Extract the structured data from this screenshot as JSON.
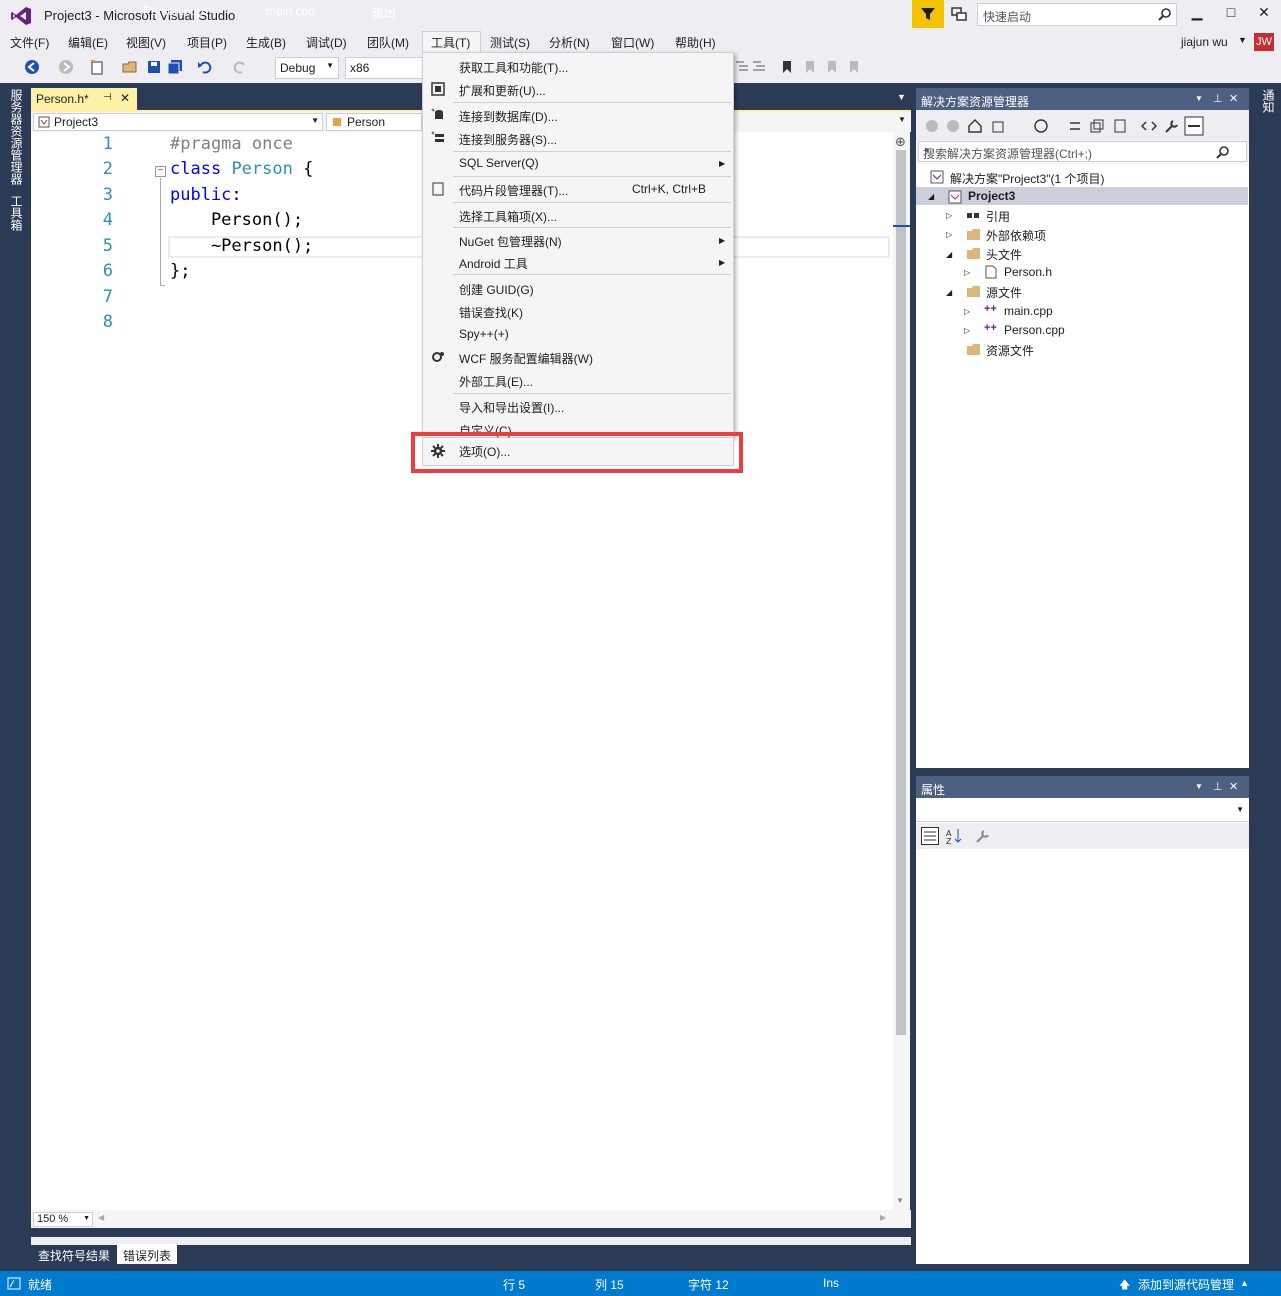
{
  "window": {
    "title": "Project3 - Microsoft Visual Studio",
    "quick_launch_placeholder": "快速启动",
    "user_name": "jiajun wu",
    "avatar_initials": "JW"
  },
  "menubar": [
    "文件(F)",
    "编辑(E)",
    "视图(V)",
    "项目(P)",
    "生成(B)",
    "调试(D)",
    "团队(M)",
    "工具(T)",
    "测试(S)",
    "分析(N)",
    "窗口(W)",
    "帮助(H)"
  ],
  "toolbar": {
    "configuration": "Debug",
    "platform": "x86"
  },
  "left_tabs": [
    "服务器资源管理器",
    "工具箱"
  ],
  "right_tab": "通知",
  "doc_tabs": {
    "tab1": "Person.h*",
    "tab1_pin": "⊣",
    "tab1_close": "✕",
    "tab2": "Person.cpp*",
    "tab3": "main.cpp",
    "tab4": "输出"
  },
  "nav_bar": {
    "project": "Project3",
    "scope": "Person"
  },
  "code": {
    "line_numbers": [
      "1",
      "2",
      "3",
      "4",
      "5",
      "6",
      "7",
      "8"
    ],
    "l1": "#pragma once",
    "l2_kw": "class",
    "l2_type": "Person",
    "l2_rest": " {",
    "l3_kw": "public",
    "l3_rest": ":",
    "l4": "    Person();",
    "l5": "    ~Person();",
    "l6": "};"
  },
  "zoom": "150 %",
  "bottom_tabs": {
    "find_symbol": "查找符号结果",
    "error_list": "错误列表"
  },
  "tools_menu": {
    "get_tools": "获取工具和功能(T)...",
    "extensions": "扩展和更新(U)...",
    "connect_db": "连接到数据库(D)...",
    "connect_server": "连接到服务器(S)...",
    "sql_server": "SQL Server(Q)",
    "code_snippets": "代码片段管理器(T)...",
    "code_snippets_shortcut": "Ctrl+K, Ctrl+B",
    "choose_toolbox": "选择工具箱项(X)...",
    "nuget": "NuGet 包管理器(N)",
    "android": "Android 工具",
    "create_guid": "创建 GUID(G)",
    "error_lookup": "错误查找(K)",
    "spy": "Spy++(+)",
    "wcf": "WCF 服务配置编辑器(W)",
    "external_tools": "外部工具(E)...",
    "import_export": "导入和导出设置(I)...",
    "customize": "自定义(C)...",
    "options": "选项(O)..."
  },
  "solution_explorer": {
    "title": "解决方案资源管理器",
    "search_placeholder": "搜索解决方案资源管理器(Ctrl+;)",
    "solution": "解决方案\"Project3\"(1 个项目)",
    "project": "Project3",
    "references": "引用",
    "external_deps": "外部依赖项",
    "header_files": "头文件",
    "person_h": "Person.h",
    "source_files": "源文件",
    "main_cpp": "main.cpp",
    "person_cpp": "Person.cpp",
    "resource_files": "资源文件"
  },
  "properties": {
    "title": "属性"
  },
  "statusbar": {
    "ready": "就绪",
    "row": "行 5",
    "col": "列 15",
    "char": "字符 12",
    "ins": "Ins",
    "source_control": "添加到源代码管理"
  },
  "colors": {
    "accent": "#007acc",
    "highlight_border": "#f03c3c",
    "active_tab": "#fff1a8",
    "panel_title": "#4d6082"
  }
}
